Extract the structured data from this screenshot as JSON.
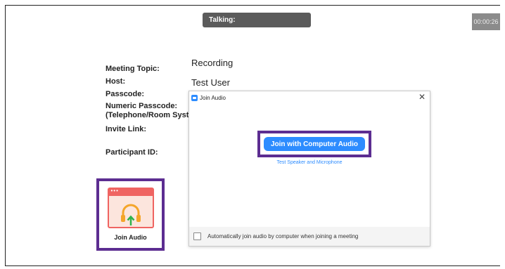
{
  "timer": "00:00:26",
  "talking_label": "Talking:",
  "meeting_info": {
    "labels": {
      "topic": "Meeting Topic:",
      "host": "Host:",
      "passcode": "Passcode:",
      "numeric_passcode_1": "Numeric Passcode:",
      "numeric_passcode_2": "(Telephone/Room System)",
      "invite_link": "Invite Link:",
      "participant_id": "Participant ID:"
    },
    "values": {
      "topic": "Recording",
      "host": "Test User"
    }
  },
  "join_audio_tile": {
    "label": "Join Audio",
    "icon": "headphones-icon",
    "dots": "•••"
  },
  "dialog": {
    "title": "Join Audio",
    "close": "✕",
    "join_button": "Join with Computer Audio",
    "test_link": "Test Speaker and Microphone",
    "auto_join_label": "Automatically join audio by computer when joining a meeting",
    "auto_join_checked": false
  },
  "colors": {
    "accent": "#2d8cff",
    "highlight": "#5c2d91",
    "tile_red": "#ef6461",
    "arrow_green": "#2fb24c",
    "headphones_orange": "#f4a52a"
  }
}
